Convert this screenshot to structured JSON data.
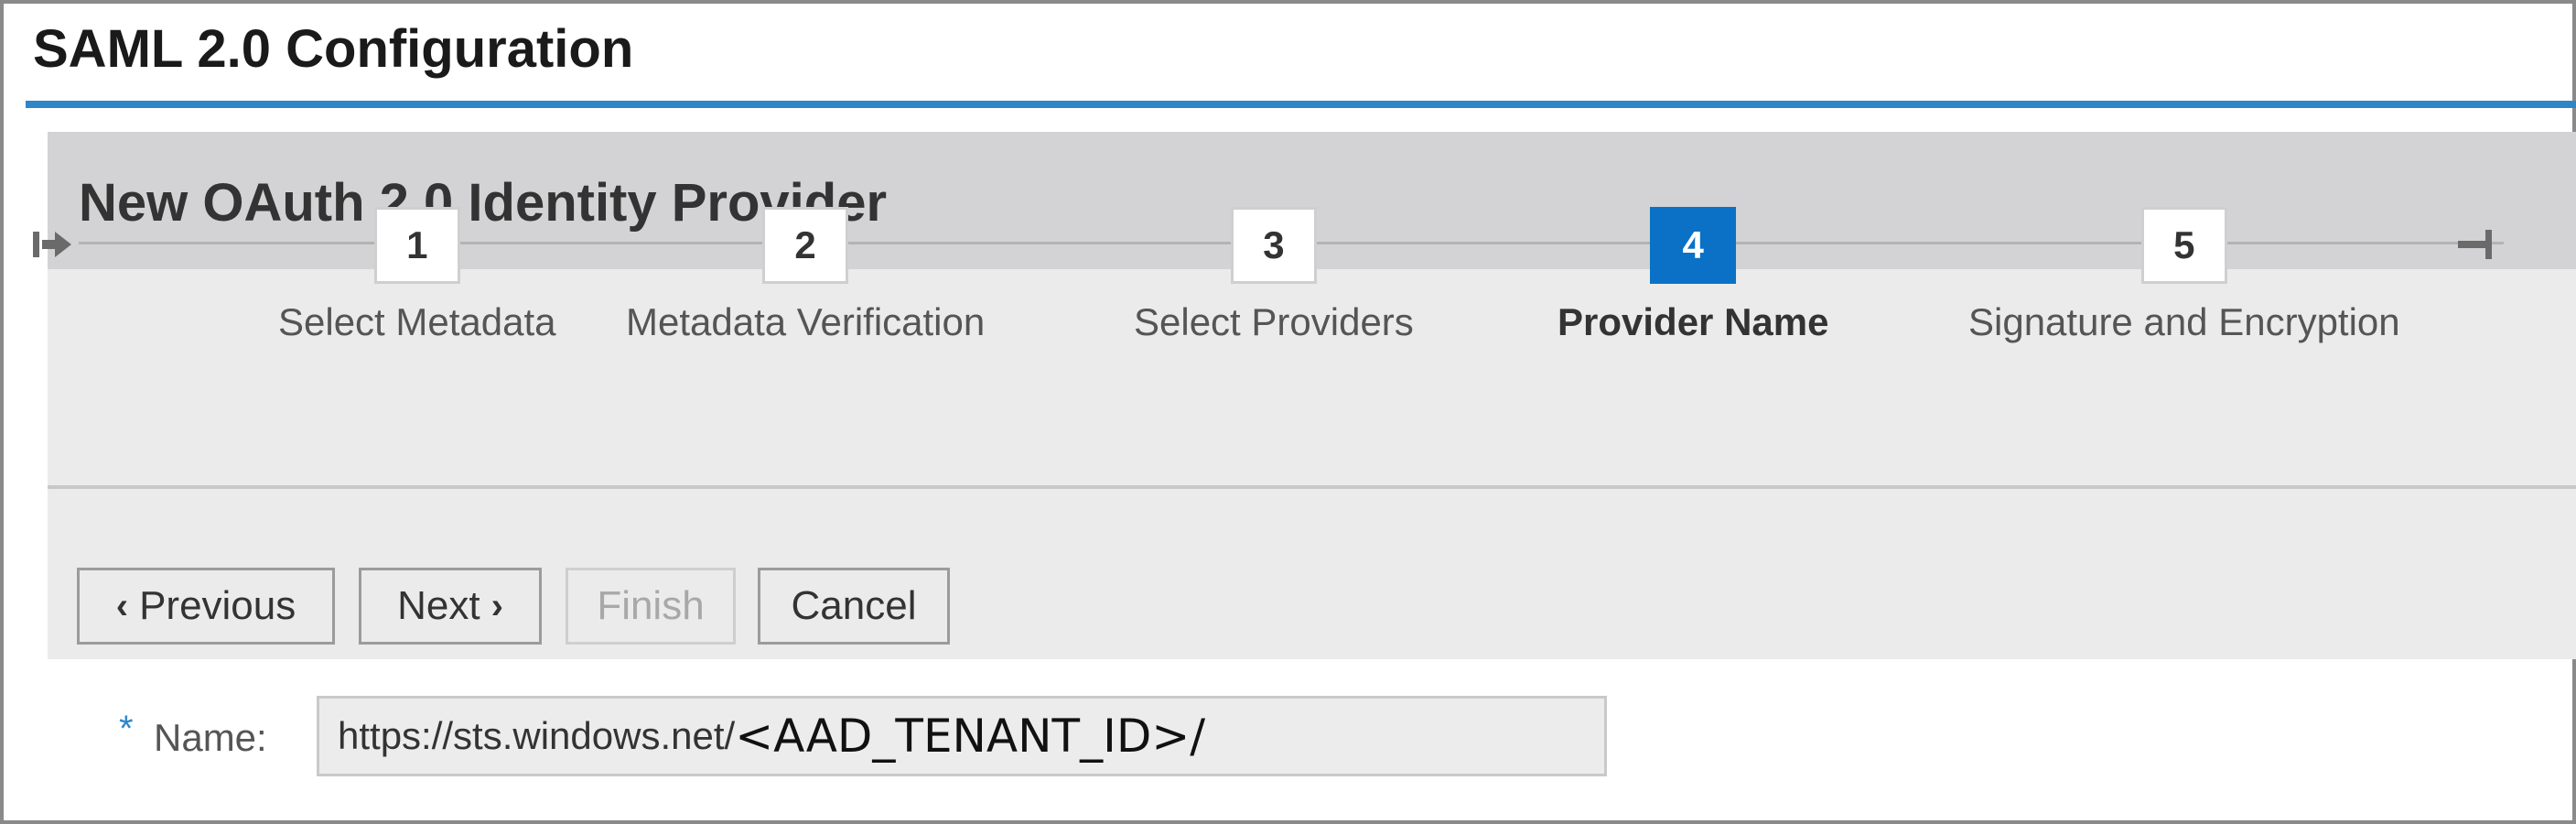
{
  "page": {
    "title": "SAML 2.0 Configuration"
  },
  "panel": {
    "title": "New OAuth 2.0 Identity Provider"
  },
  "stepper": {
    "icons": {
      "start": "step-start-icon",
      "end": "step-end-icon"
    },
    "current_step": 4,
    "steps": [
      {
        "number": "1",
        "label": "Select Metadata",
        "state": "inactive"
      },
      {
        "number": "2",
        "label": "Metadata Verification",
        "state": "inactive"
      },
      {
        "number": "3",
        "label": "Select Providers",
        "state": "inactive"
      },
      {
        "number": "4",
        "label": "Provider Name",
        "state": "active"
      },
      {
        "number": "5",
        "label": "Signature and Encryption",
        "state": "inactive"
      }
    ]
  },
  "toolbar": {
    "previous_label": "Previous",
    "next_label": "Next",
    "finish_label": "Finish",
    "cancel_label": "Cancel",
    "finish_disabled": true
  },
  "form": {
    "name": {
      "required_marker": "*",
      "label": "Name:",
      "value_url": "https://sts.windows.net/",
      "value_placeholder": "<AAD_TENANT_ID>/"
    }
  },
  "colors": {
    "accent": "#2e86c8",
    "active_step": "#0a71c7",
    "panel_header": "#d3d3d5",
    "panel_bg": "#ebebeb"
  }
}
